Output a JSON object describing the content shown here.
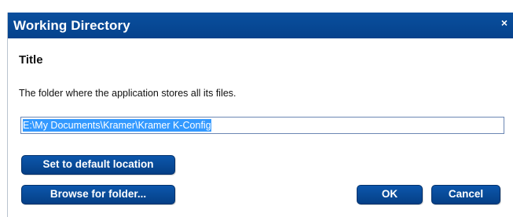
{
  "dialog": {
    "title": "Working Directory",
    "close_glyph": "×"
  },
  "content": {
    "heading": "Title",
    "description": "The folder where the application stores all its files.",
    "path_value": "E:\\My Documents\\Kramer\\Kramer K-Config"
  },
  "buttons": {
    "default_location": "Set to default location",
    "browse": "Browse for folder...",
    "ok": "OK",
    "cancel": "Cancel"
  },
  "colors": {
    "titlebar": "#05428c",
    "button": "#053f86",
    "selection": "#3399ff"
  }
}
